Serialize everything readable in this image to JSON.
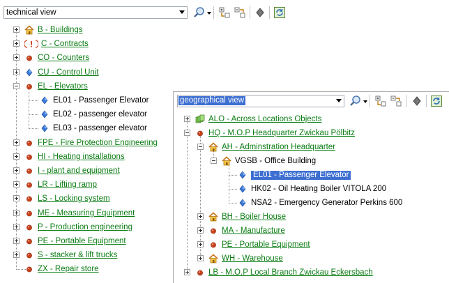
{
  "tech": {
    "view_value": "technical view",
    "items": [
      {
        "label": "B - Buildings",
        "icon": "house-icon",
        "link": true
      },
      {
        "label": "C - Contracts",
        "icon": "contract-warning-icon",
        "link": true
      },
      {
        "label": "CO - Counters",
        "icon": "red-dot-icon",
        "link": true
      },
      {
        "label": "CU - Control Unit",
        "icon": "blue-diamond-icon",
        "link": true
      },
      {
        "label": "EL - Elevators",
        "icon": "red-dot-icon",
        "link": true
      },
      {
        "label": "EL01 - Passenger Elevator",
        "icon": "blue-diamond-icon",
        "link": false
      },
      {
        "label": "EL02 - passenger elevator",
        "icon": "blue-diamond-icon",
        "link": false
      },
      {
        "label": "EL03 - passenger elevator",
        "icon": "blue-diamond-icon",
        "link": false
      },
      {
        "label": "FPE - Fire Protection Engineering",
        "icon": "red-dot-icon",
        "link": true
      },
      {
        "label": "HI - Heating installations",
        "icon": "red-dot-icon",
        "link": true
      },
      {
        "label": "I - plant and equipment",
        "icon": "red-dot-icon",
        "link": true
      },
      {
        "label": "LR - Lifting ramp",
        "icon": "red-dot-icon",
        "link": true
      },
      {
        "label": "LS - Locking system",
        "icon": "red-dot-icon",
        "link": true
      },
      {
        "label": "ME - Measuring Equipment",
        "icon": "red-dot-icon",
        "link": true
      },
      {
        "label": "P - Production engineering",
        "icon": "red-dot-icon",
        "link": true
      },
      {
        "label": "PE - Portable Equipment",
        "icon": "red-dot-icon",
        "link": true
      },
      {
        "label": "S - stacker & lift trucks",
        "icon": "red-dot-icon",
        "link": true
      },
      {
        "label": "ZX - Repair store",
        "icon": "red-dot-icon",
        "link": true
      }
    ]
  },
  "geo": {
    "view_value": "geographical view",
    "items": [
      {
        "label": "ALO - Across Locations Objects",
        "icon": "green-stack-icon",
        "link": true
      },
      {
        "label": "HQ - M.O.P Headquarter Zwickau Pölbitz",
        "icon": "red-dot-icon",
        "link": true
      },
      {
        "label": "AH - Adminstration  Headquarter",
        "icon": "house-icon",
        "link": true
      },
      {
        "label": "VGSB - Office Building",
        "icon": "house-icon",
        "link": false
      },
      {
        "label": "EL01 - Passenger Elevator",
        "icon": "blue-diamond-icon",
        "link": false,
        "selected": true
      },
      {
        "label": "HK02 - Oil Heating Boiler VITOLA 200",
        "icon": "blue-diamond-icon",
        "link": false
      },
      {
        "label": "NSA2 - Emergency Generator Perkins 600",
        "icon": "blue-diamond-icon",
        "link": false
      },
      {
        "label": "BH - Boiler House",
        "icon": "house-icon",
        "link": true
      },
      {
        "label": "MA - Manufacture",
        "icon": "red-dot-icon",
        "link": true
      },
      {
        "label": "PE - Portable Equipment",
        "icon": "red-dot-icon",
        "link": true
      },
      {
        "label": "WH - Warehouse",
        "icon": "house-icon",
        "link": true
      },
      {
        "label": "LB - M.O.P Local Branch Zwickau Eckersbach",
        "icon": "red-dot-icon",
        "link": true
      }
    ]
  },
  "colors": {
    "link": "#0b7d14",
    "selection": "#3d6fd1",
    "red_dot": "#c9411c",
    "blue_diamond": "#3a78d8"
  }
}
